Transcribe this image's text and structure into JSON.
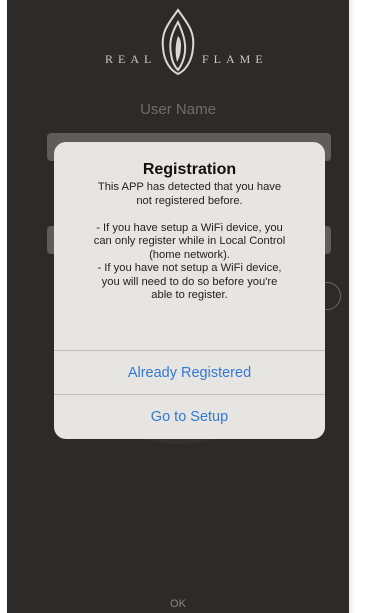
{
  "logo": {
    "left_word": "REAL",
    "right_word": "FLAME",
    "icon": "flame-icon"
  },
  "form": {
    "username_label": "User Name",
    "ok_label": "OK"
  },
  "alert": {
    "title": "Registration",
    "message": "This APP has detected that you have\nnot registered before.\n\n- If you have setup a WiFi device, you\ncan only register while in Local Control\n(home network).\n- If you have not setup a WiFi device,\nyou will need to do so before you're\nable to register.",
    "buttons": {
      "already_registered": "Already Registered",
      "go_to_setup": "Go to Setup"
    }
  },
  "colors": {
    "background": "#2c2b2a",
    "alert_background": "#e7e5e2",
    "action_blue": "#2f7ad6"
  }
}
